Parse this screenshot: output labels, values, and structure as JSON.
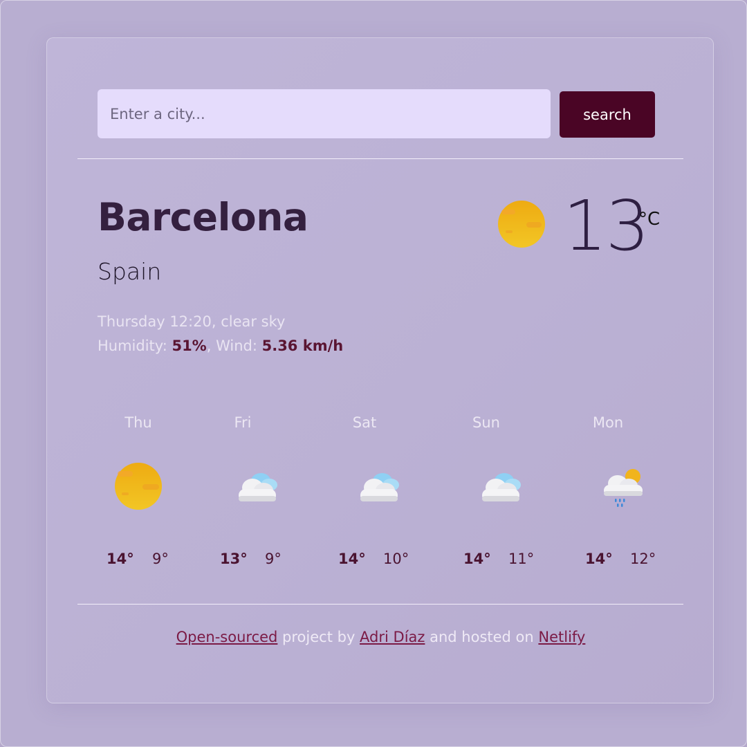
{
  "search": {
    "placeholder": "Enter a city...",
    "button_label": "search"
  },
  "current": {
    "city": "Barcelona",
    "country": "Spain",
    "datetime_description": "Thursday 12:20, clear sky",
    "humidity_label": "Humidity: ",
    "humidity_value": "51%",
    "wind_label": ", Wind: ",
    "wind_value": "5.36 km/h",
    "temperature": "13",
    "unit": "°C",
    "icon": "sun-icon"
  },
  "forecast": [
    {
      "day": "Thu",
      "icon": "sun-icon",
      "max": "14°",
      "min": "9°"
    },
    {
      "day": "Fri",
      "icon": "cloud-icon",
      "max": "13°",
      "min": "9°"
    },
    {
      "day": "Sat",
      "icon": "cloud-icon",
      "max": "14°",
      "min": "10°"
    },
    {
      "day": "Sun",
      "icon": "cloud-icon",
      "max": "14°",
      "min": "11°"
    },
    {
      "day": "Mon",
      "icon": "rain-sun-cloud-icon",
      "max": "14°",
      "min": "12°"
    }
  ],
  "footer": {
    "link1": "Open-sourced",
    "text1": " project by ",
    "link2": "Adri Díaz",
    "text2": " and hosted on ",
    "link3": "Netlify"
  },
  "colors": {
    "background": "#b4a8cb",
    "input_bg": "#e5dcfc",
    "button_bg": "#4a0525",
    "city_text": "#34203f",
    "accent": "#7b1a45"
  }
}
